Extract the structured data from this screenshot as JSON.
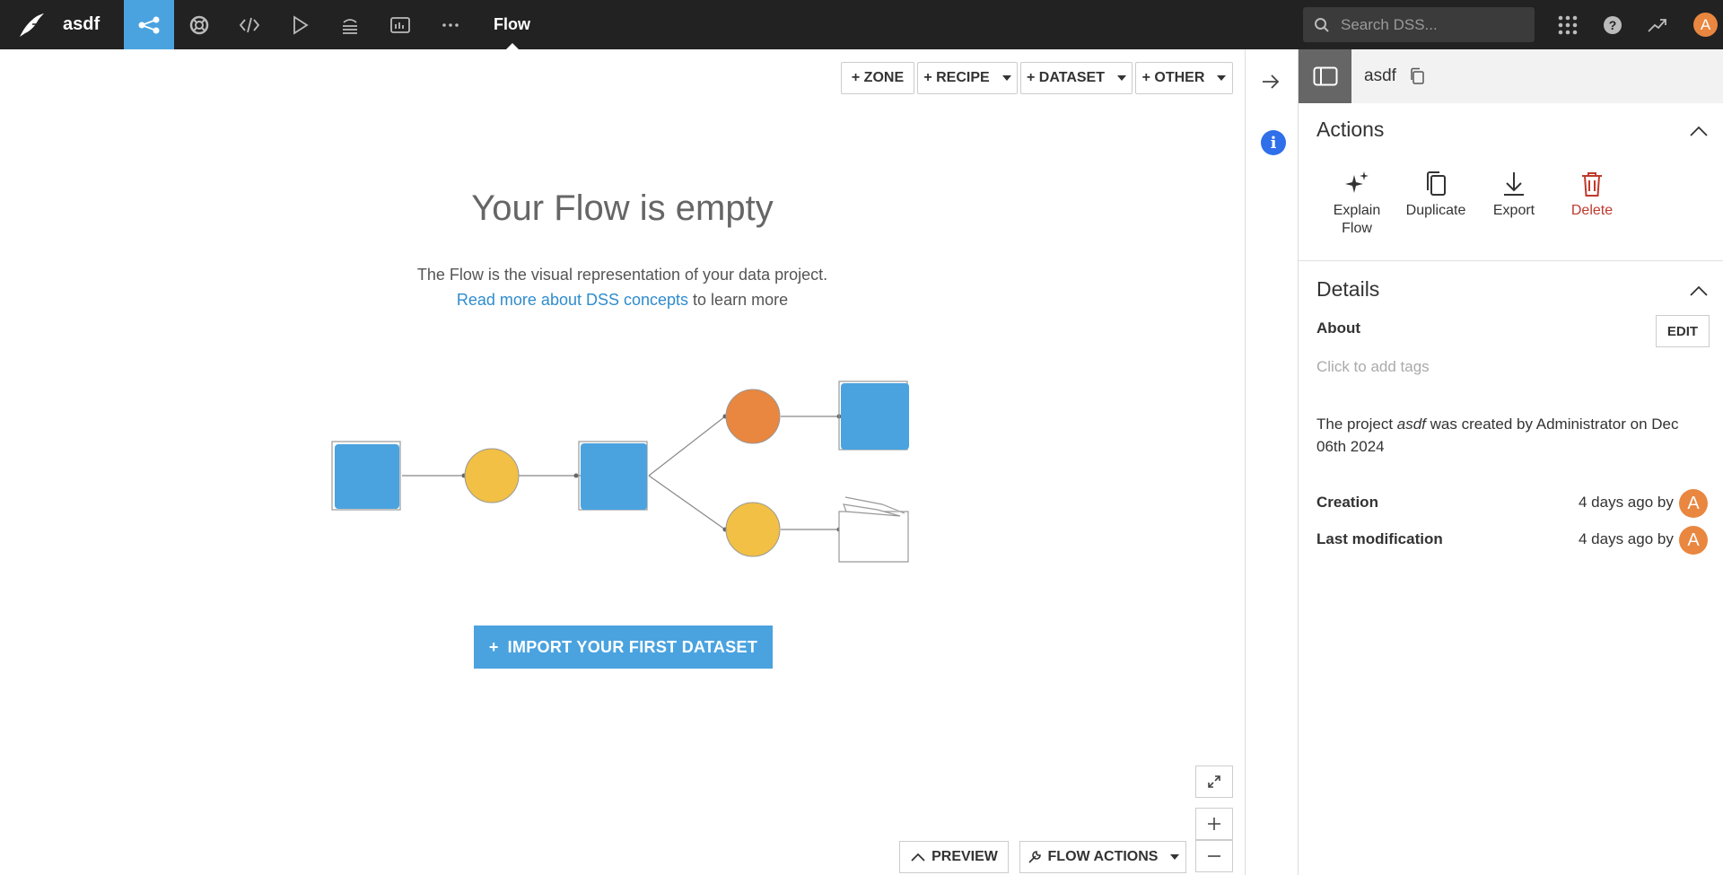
{
  "topbar": {
    "project_name": "asdf",
    "nav_title": "Flow",
    "search_placeholder": "Search DSS...",
    "user_initial": "A",
    "accent_color": "#4aa3df"
  },
  "canvas": {
    "toolbar": {
      "zone": "+ ZONE",
      "recipe": "+ RECIPE",
      "dataset": "+ DATASET",
      "other": "+ OTHER"
    },
    "empty_title": "Your Flow is empty",
    "empty_line1": "The Flow is the visual representation of your data project.",
    "empty_link": "Read more about DSS concepts",
    "empty_line2_suffix": " to learn more",
    "import_button": "IMPORT YOUR FIRST DATASET",
    "preview_button": "PREVIEW",
    "flow_actions_button": "FLOW ACTIONS"
  },
  "panel": {
    "object_name": "asdf",
    "actions_title": "Actions",
    "actions": [
      {
        "label_line1": "Explain",
        "label_line2": "Flow",
        "icon": "sparkles-icon"
      },
      {
        "label_line1": "Duplicate",
        "label_line2": "",
        "icon": "copy-icon"
      },
      {
        "label_line1": "Export",
        "label_line2": "",
        "icon": "download-icon"
      },
      {
        "label_line1": "Delete",
        "label_line2": "",
        "icon": "trash-icon"
      }
    ],
    "details_title": "Details",
    "about_label": "About",
    "edit_button": "EDIT",
    "tags_placeholder": "Click to add tags",
    "desc_prefix": "The project ",
    "desc_project": "asdf",
    "desc_suffix": " was created by Administrator on Dec 06th 2024",
    "creation_label": "Creation",
    "creation_value": "4 days ago by",
    "modification_label": "Last modification",
    "modification_value": "4 days ago by",
    "user_initial": "A",
    "delete_color": "#c0392b"
  }
}
